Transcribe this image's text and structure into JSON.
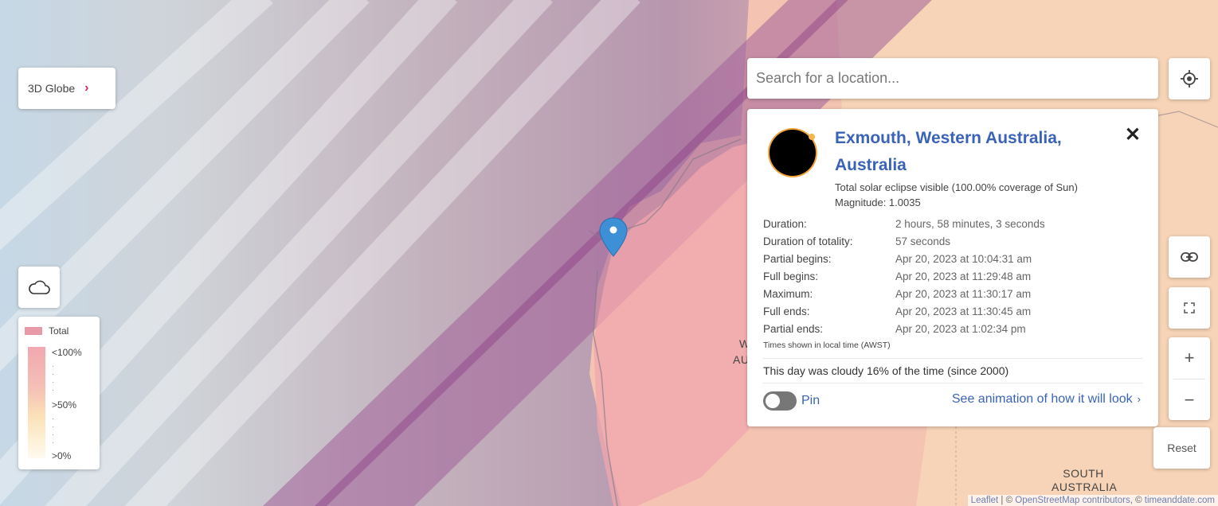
{
  "controls": {
    "globe_label": "3D Globe",
    "globe_chevron": "›",
    "search_placeholder": "Search for a location...",
    "reset_label": "Reset",
    "zoom_in": "+",
    "zoom_out": "−"
  },
  "legend": {
    "total": "Total",
    "lt100": "<100%",
    "gt50": ">50%",
    "gt0": ">0%"
  },
  "popup": {
    "title": "Exmouth, Western Australia, Australia",
    "visibility": "Total solar eclipse visible (100.00% coverage of Sun)",
    "magnitude": "Magnitude: 1.0035",
    "rows": [
      {
        "label": "Duration:",
        "value": "2 hours, 58 minutes, 3 seconds"
      },
      {
        "label": "Duration of totality:",
        "value": "57 seconds"
      },
      {
        "label": "Partial begins:",
        "value": "Apr 20, 2023 at 10:04:31 am"
      },
      {
        "label": "Full begins:",
        "value": "Apr 20, 2023 at 11:29:48 am"
      },
      {
        "label": "Maximum:",
        "value": "Apr 20, 2023 at 11:30:17 am"
      },
      {
        "label": "Full ends:",
        "value": "Apr 20, 2023 at 11:30:45 am"
      },
      {
        "label": "Partial ends:",
        "value": "Apr 20, 2023 at 1:02:34 pm"
      }
    ],
    "timezone_note": "Times shown in local time (AWST)",
    "cloudy_note": "This day was cloudy 16% of the time (since 2000)",
    "pin_label": "Pin",
    "pin_on": false,
    "animation_link": "See animation of how it will look",
    "animation_arrow": "›",
    "close": "✕"
  },
  "map_labels": {
    "partial_wa": "W",
    "partial_au": "AU",
    "south_australia_1": "SOUTH",
    "south_australia_2": "AUSTRALIA"
  },
  "attribution": {
    "leaflet": "Leaflet",
    "sep1": " | © ",
    "osm": "OpenStreetMap contributors",
    "sep2": ", © ",
    "tad": "timeanddate.com"
  },
  "colors": {
    "totality_path": "#b07aa5",
    "land_total": "#eeaaa8",
    "accent_link": "#3a63b8",
    "chevron": "#d1246b",
    "marker": "#3d8fd6"
  }
}
